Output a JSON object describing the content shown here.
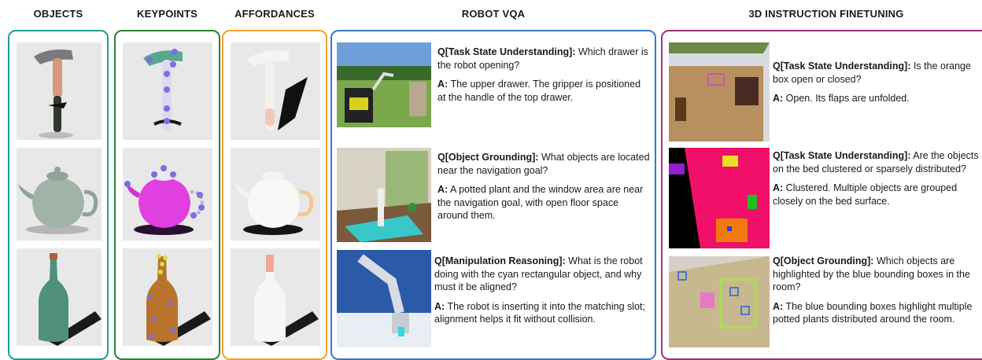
{
  "headers": {
    "objects": "OBJECTS",
    "keypoints": "KEYPOINTS",
    "affordances": "AFFORDANCES",
    "robot_vqa": "ROBOT VQA",
    "instruction_ft": "3D INSTRUCTION FINETUNING"
  },
  "colors": {
    "objects": "#1f9e8f",
    "keypoints": "#2e7d32",
    "affordances": "#f0a030",
    "robot_vqa": "#3a78c8",
    "instruction_ft": "#a0307a"
  },
  "robot_vqa": [
    {
      "q_tag": "Q[Task State Understanding]:",
      "q_text": " Which drawer is the robot opening?",
      "a_tag": "A:",
      "a_text": " The upper drawer. The gripper is positioned at the handle of the top drawer."
    },
    {
      "q_tag": "Q[Object Grounding]:",
      "q_text": " What objects are located near the navigation goal?",
      "a_tag": "A:",
      "a_text": " A potted plant and the window area are near the navigation goal, with open floor space around them."
    },
    {
      "q_tag": "Q[Manipulation Reasoning]:",
      "q_text": " What is the robot doing with the cyan rectangular object, and why must it be aligned?",
      "a_tag": "A:",
      "a_text": " The robot is inserting it into the matching slot; alignment helps it fit without collision."
    }
  ],
  "instruction_ft": [
    {
      "q_tag": "Q[Task State Understanding]:",
      "q_text": " Is the orange box open or closed?",
      "a_tag": "A:",
      "a_text": " Open. Its flaps are unfolded."
    },
    {
      "q_tag": "Q[Task State Understanding]:",
      "q_text": " Are the objects on the bed clustered or sparsely distributed?",
      "a_tag": "A:",
      "a_text": " Clustered. Multiple objects are grouped closely on the bed surface."
    },
    {
      "q_tag": "Q[Object Grounding]:",
      "q_text": " Which objects are highlighted by the blue bounding boxes in the room?",
      "a_tag": "A:",
      "a_text": " The blue bounding boxes highlight multiple potted plants distributed around the room."
    }
  ]
}
